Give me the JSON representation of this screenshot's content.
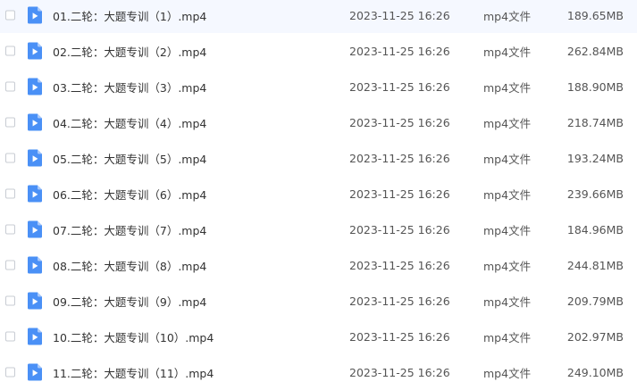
{
  "icon": "video-file-icon",
  "colors": {
    "icon_fill": "#4a90f6",
    "icon_fold": "#a9c9fb"
  },
  "files": [
    {
      "name": "01.二轮：大题专训（1）.mp4",
      "date": "2023-11-25 16:26",
      "type": "mp4文件",
      "size": "189.65MB"
    },
    {
      "name": "02.二轮：大题专训（2）.mp4",
      "date": "2023-11-25 16:26",
      "type": "mp4文件",
      "size": "262.84MB"
    },
    {
      "name": "03.二轮：大题专训（3）.mp4",
      "date": "2023-11-25 16:26",
      "type": "mp4文件",
      "size": "188.90MB"
    },
    {
      "name": "04.二轮：大题专训（4）.mp4",
      "date": "2023-11-25 16:26",
      "type": "mp4文件",
      "size": "218.74MB"
    },
    {
      "name": "05.二轮：大题专训（5）.mp4",
      "date": "2023-11-25 16:26",
      "type": "mp4文件",
      "size": "193.24MB"
    },
    {
      "name": "06.二轮：大题专训（6）.mp4",
      "date": "2023-11-25 16:26",
      "type": "mp4文件",
      "size": "239.66MB"
    },
    {
      "name": "07.二轮：大题专训（7）.mp4",
      "date": "2023-11-25 16:26",
      "type": "mp4文件",
      "size": "184.96MB"
    },
    {
      "name": "08.二轮：大题专训（8）.mp4",
      "date": "2023-11-25 16:26",
      "type": "mp4文件",
      "size": "244.81MB"
    },
    {
      "name": "09.二轮：大题专训（9）.mp4",
      "date": "2023-11-25 16:26",
      "type": "mp4文件",
      "size": "209.79MB"
    },
    {
      "name": "10.二轮：大题专训（10）.mp4",
      "date": "2023-11-25 16:26",
      "type": "mp4文件",
      "size": "202.97MB"
    },
    {
      "name": "11.二轮：大题专训（11）.mp4",
      "date": "2023-11-25 16:26",
      "type": "mp4文件",
      "size": "249.10MB"
    }
  ]
}
